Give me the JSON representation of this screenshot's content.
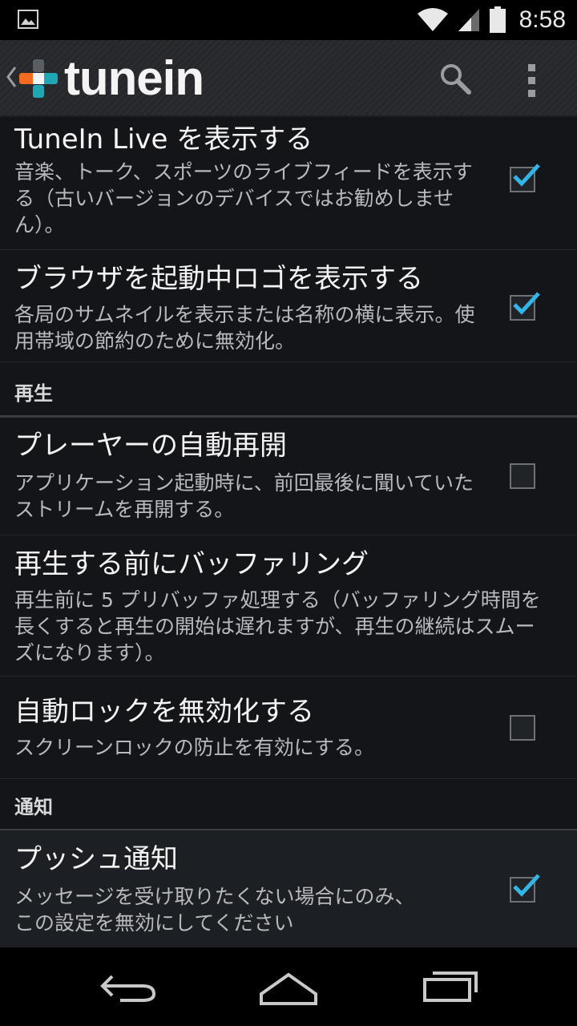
{
  "status_bar": {
    "time": "8:58"
  },
  "action_bar": {
    "logo_text": "tunein"
  },
  "settings": {
    "items": [
      {
        "title": "TuneIn Live を表示する",
        "summary": "音楽、トーク、スポーツのライブフィードを表示する（古いバージョンのデバイスではお勧めしません）。",
        "checked": true
      },
      {
        "title": "ブラウザを起動中ロゴを表示する",
        "summary": "各局のサムネイルを表示または名称の横に表示。使用帯域の節約のために無効化。",
        "checked": true
      }
    ],
    "category_playback": "再生",
    "playback_items": [
      {
        "title": "プレーヤーの自動再開",
        "summary": "アプリケーション起動時に、前回最後に聞いていたストリームを再開する。",
        "checked": false
      },
      {
        "title": "再生する前にバッファリング",
        "summary": "再生前に 5 プリバッファ処理する（バッファリング時間を長くすると再生の開始は遅れますが、再生の継続はスムーズになります）。",
        "checked": false
      },
      {
        "title": "自動ロックを無効化する",
        "summary": "スクリーンロックの防止を有効にする。",
        "checked": false
      }
    ],
    "category_notifications": "通知",
    "notification_items": [
      {
        "title": "プッシュ通知",
        "summary": "メッセージを受け取りたくない場合にのみ、この設定を無効にしてください",
        "checked": true
      }
    ]
  },
  "colors": {
    "accent": "#33b5e5",
    "logo_orange": "#f26b21",
    "logo_teal": "#1fa7b3"
  }
}
